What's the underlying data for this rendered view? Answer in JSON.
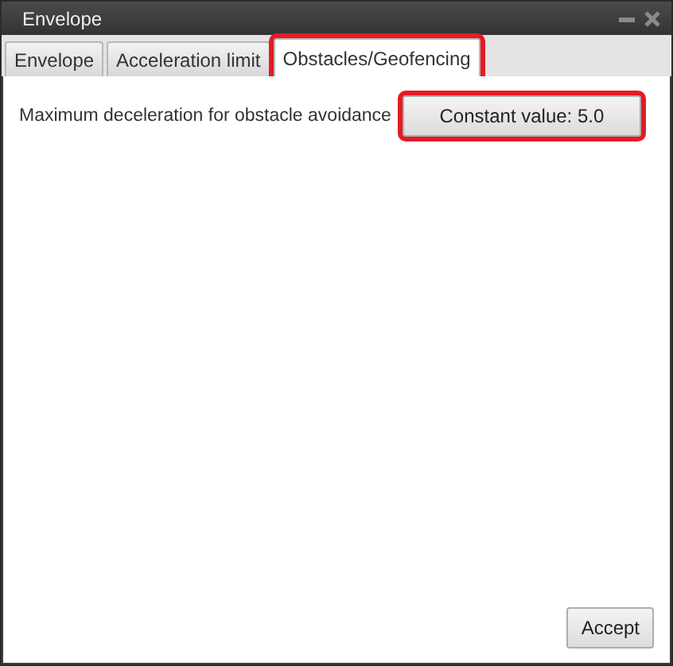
{
  "window": {
    "title": "Envelope"
  },
  "tabs": [
    {
      "label": "Envelope",
      "selected": false,
      "highlighted": false
    },
    {
      "label": "Acceleration limit",
      "selected": false,
      "highlighted": false
    },
    {
      "label": "Obstacles/Geofencing",
      "selected": true,
      "highlighted": true
    }
  ],
  "settings": [
    {
      "label": "Maximum deceleration for obstacle avoidance",
      "button": "Constant value: 5.0",
      "highlighted": true
    }
  ],
  "buttons": [
    "Accept"
  ]
}
